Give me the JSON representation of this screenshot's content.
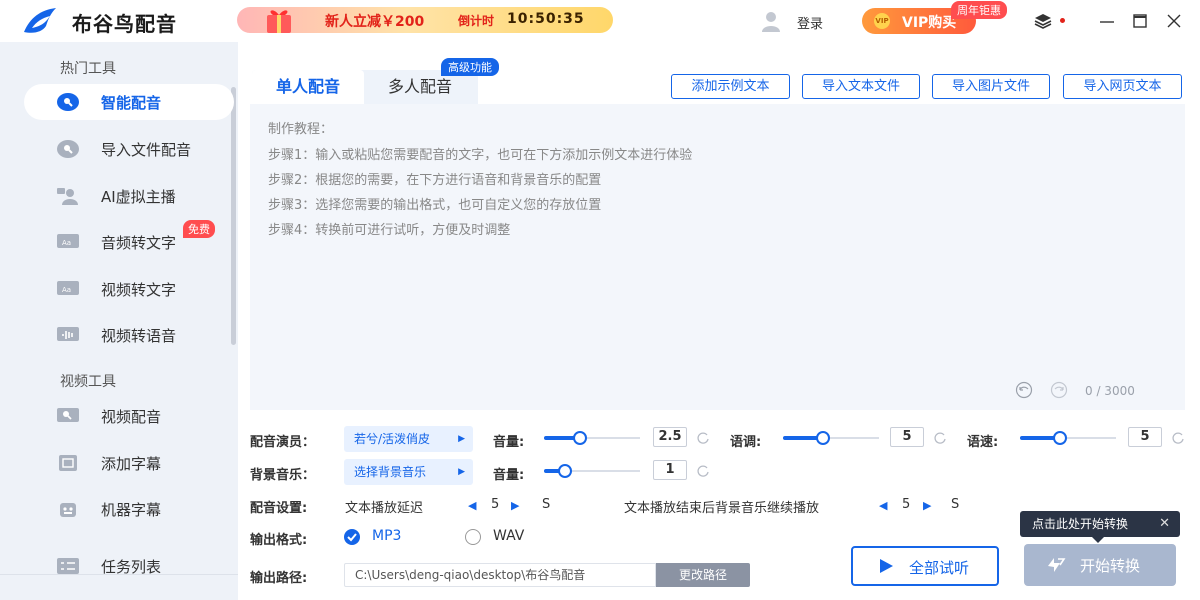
{
  "app": {
    "title": "布谷鸟配音"
  },
  "promo": {
    "text": "新人立减￥200",
    "countdown_label": "倒计时",
    "countdown": "10:50:35"
  },
  "header": {
    "login": "登录",
    "vip": "VIP购买",
    "anniversary": "周年钜惠"
  },
  "sidebar": {
    "section_hot": "热门工具",
    "section_video": "视频工具",
    "free_badge": "免费",
    "items": [
      {
        "label": "智能配音",
        "icon": "microphone-icon"
      },
      {
        "label": "导入文件配音",
        "icon": "file-microphone-icon"
      },
      {
        "label": "AI虚拟主播",
        "icon": "anchor-icon"
      },
      {
        "label": "音频转文字",
        "icon": "audio-text-icon"
      },
      {
        "label": "视频转文字",
        "icon": "video-text-icon"
      },
      {
        "label": "视频转语音",
        "icon": "video-audio-icon"
      },
      {
        "label": "视频配音",
        "icon": "video-dub-icon"
      },
      {
        "label": "添加字幕",
        "icon": "subtitle-icon"
      },
      {
        "label": "机器字幕",
        "icon": "robot-icon"
      },
      {
        "label": "任务列表",
        "icon": "task-list-icon"
      }
    ]
  },
  "tabs": {
    "single": "单人配音",
    "multi": "多人配音",
    "advanced_badge": "高级功能"
  },
  "toolbar": {
    "add_sample": "添加示例文本",
    "import_text": "导入文本文件",
    "import_image": "导入图片文件",
    "import_web": "导入网页文本"
  },
  "editor": {
    "tutorial_title": "制作教程：",
    "steps": [
      "步骤1：输入或粘贴您需要配音的文字，也可在下方添加示例文本进行体验",
      "步骤2：根据您的需要，在下方进行语音和背景音乐的配置",
      "步骤3：选择您需要的输出格式，也可自定义您的存放位置",
      "步骤4：转换前可进行试听，方便及时调整"
    ],
    "char_count": "0 / 3000"
  },
  "settings": {
    "voice_label": "配音演员：",
    "voice_value": "若兮/活泼俏皮",
    "volume_label": "音量:",
    "voice_volume": "2.5",
    "voice_volume_level": 0.38,
    "pitch_label": "语调:",
    "pitch": "5",
    "pitch_level": 0.42,
    "speed_label": "语速:",
    "speed": "5",
    "speed_level": 0.42,
    "bgm_label": "背景音乐：",
    "bgm_value": "选择背景音乐",
    "bgm_volume": "1",
    "bgm_volume_level": 0.22,
    "config_label": "配音设置:",
    "delay_label": "文本播放延迟",
    "delay_value": "5",
    "delay_unit": "S",
    "after_label": "文本播放结束后背景音乐继续播放",
    "after_value": "5",
    "after_unit": "S",
    "format_label": "输出格式:",
    "format_mp3": "MP3",
    "format_wav": "WAV",
    "path_label": "输出路径:",
    "path_value": "C:\\Users\\deng-qiao\\desktop\\布谷鸟配音",
    "path_change": "更改路径"
  },
  "actions": {
    "preview": "全部试听",
    "convert": "开始转换",
    "tooltip": "点击此处开始转换"
  },
  "colors": {
    "accent": "#1565e8",
    "danger": "#ff4d4f",
    "vip": "#ff7a3c"
  }
}
